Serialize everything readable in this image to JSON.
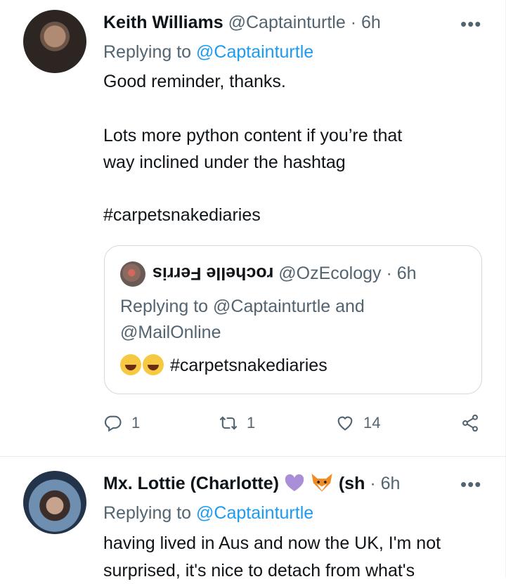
{
  "tweet1": {
    "display_name": "Keith Williams",
    "handle": "@Captainturtle",
    "separator": "·",
    "time": "6h",
    "more": "•••",
    "replying_prefix": "Replying to",
    "replying_handle": "@Captainturtle",
    "text_line1": "Good reminder, thanks.",
    "text_line2": "Lots more python content if you’re that",
    "text_line3": "way inclined under the hashtag",
    "hashtag": "#carpetsnakediaries",
    "quote": {
      "display_name": "rochelle Ferris",
      "handle": "@OzEcology",
      "separator": "·",
      "time": "6h",
      "replying_line1": "Replying to @Captainturtle and",
      "replying_line2": "@MailOnline",
      "hashtag": "#carpetsnakediaries"
    },
    "actions": {
      "reply_count": "1",
      "retweet_count": "1",
      "like_count": "14"
    }
  },
  "tweet2": {
    "display_name": "Mx. Lottie (Charlotte)",
    "name_suffix": "(sh",
    "separator": "·",
    "time": "6h",
    "more": "•••",
    "replying_prefix": "Replying to",
    "replying_handle": "@Captainturtle",
    "text_line1": "having lived in Aus and now the UK, I'm not",
    "text_line2": "surprised, it's nice to detach from what's"
  },
  "colors": {
    "link": "#1d9bf0",
    "muted": "#536471",
    "border": "#cfd9de"
  },
  "icons": [
    "more-icon",
    "reply-icon",
    "retweet-icon",
    "like-icon",
    "share-icon",
    "purple-heart-icon",
    "fox-icon",
    "laughing-emoji-icon"
  ]
}
